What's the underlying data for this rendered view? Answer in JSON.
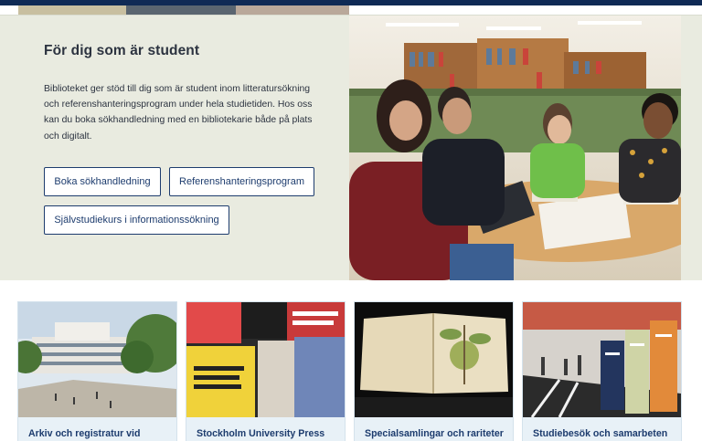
{
  "hero": {
    "title": "För dig som är student",
    "description": "Biblioteket ger stöd till dig som är student inom litteratursökning och referenshanteringsprogram under hela studietiden. Hos oss kan du boka sökhandledning med en bibliotekarie både på plats och digitalt.",
    "buttons": [
      {
        "label": "Boka sökhandledning"
      },
      {
        "label": "Referenshanteringsprogram"
      },
      {
        "label": "Självstudiekurs i informationssökning"
      }
    ]
  },
  "cards": [
    {
      "label": "Arkiv och registratur vid"
    },
    {
      "label": "Stockholm University Press"
    },
    {
      "label": "Specialsamlingar och rariteter"
    },
    {
      "label": "Studiebesök och samarbeten"
    }
  ],
  "colors": {
    "navy": "#0f2a55",
    "hero_bg": "#e9ebe0",
    "card_bg": "#e8f1f7",
    "link": "#1d3c6e"
  }
}
